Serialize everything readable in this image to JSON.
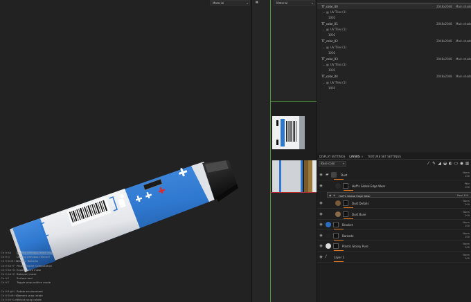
{
  "viewport3d": {
    "material_dropdown": "Material",
    "shortcuts": [
      {
        "key": "Ctrl+Alt",
        "action": "Display previous mesh map",
        "highlight": true
      },
      {
        "key": "Ctrl+Q",
        "action": "Display previous channel",
        "highlight": false
      },
      {
        "key": "Ctrl+Shift+Q",
        "action": "Display Textures",
        "highlight": false
      },
      {
        "key": "Ctrl+Alt+F",
        "action": "Pause Engine Computation",
        "highlight": false
      },
      {
        "key": "Ctrl+Alt+D",
        "action": "Export quick mask",
        "highlight": false
      },
      {
        "key": "Ctrl+Alt+E",
        "action": "Bakeport mask",
        "highlight": false
      },
      {
        "key": "Ctrl+E",
        "action": "Surface tool",
        "highlight": false
      },
      {
        "key": "Ctrl+T",
        "action": "Toggle wrap edition mode",
        "highlight": false
      },
      {
        "key": "",
        "action": "",
        "highlight": false
      },
      {
        "key": "Ctrl+Right",
        "action": "Rotate environment",
        "highlight": false
      },
      {
        "key": "Ctrl+Shift+Alt",
        "action": "Camera snap rotate",
        "highlight": false
      },
      {
        "key": "Ctrl+Alt+Left",
        "action": "Unlock snap rotate",
        "highlight": false
      }
    ]
  },
  "viewport2d": {
    "material_dropdown": "Material"
  },
  "texture_sets": [
    {
      "name": "TT_color_00",
      "resolution": "2048x2048",
      "shader": "Main shader",
      "uv_tiles_label": "UV Tiles (1)",
      "tile": "1001",
      "selected": true
    },
    {
      "name": "TT_color_01",
      "resolution": "2048x2048",
      "shader": "Main shader",
      "uv_tiles_label": "UV Tiles (1)",
      "tile": "1001",
      "selected": false
    },
    {
      "name": "TT_color_02",
      "resolution": "2048x2048",
      "shader": "Main shader",
      "uv_tiles_label": "UV Tiles (1)",
      "tile": "1001",
      "selected": false
    },
    {
      "name": "TT_color_03",
      "resolution": "2048x2048",
      "shader": "Main shader",
      "uv_tiles_label": "UV Tiles (1)",
      "tile": "1001",
      "selected": false
    },
    {
      "name": "TT_color_04",
      "resolution": "2048x2048",
      "shader": "Main shader",
      "uv_tiles_label": "UV Tiles (1)",
      "tile": "1001",
      "selected": false
    }
  ],
  "tabs": [
    {
      "label": "DISPLAY SETTINGS",
      "active": false,
      "closable": false
    },
    {
      "label": "LAYERS",
      "active": true,
      "closable": true
    },
    {
      "label": "TEXTURE SET SETTINGS",
      "active": false,
      "closable": false
    }
  ],
  "layer_toolbar": {
    "blend_mode": "Base color",
    "tools": [
      "brush-icon",
      "pen-icon",
      "fill-icon",
      "bucket-icon",
      "palette-icon",
      "folder-icon",
      "mask-icon",
      "trash-icon"
    ]
  },
  "layers": [
    {
      "name": "Dust",
      "blend": "Norm",
      "opacity": "100",
      "thumb": "#444444",
      "type": "folder"
    },
    {
      "name": "Huff's Global Edge Wear",
      "blend": "Pthr",
      "opacity": "100",
      "thumb": "#2a2a2a",
      "type": "fill"
    },
    {
      "name": "Huff's Global Edge Wear",
      "blend": "Repl",
      "opacity": "100",
      "thumb": "#1f1f1f",
      "type": "effect"
    },
    {
      "name": "Dust Details",
      "blend": "Norm",
      "opacity": "100",
      "thumb": "#7a5a3a",
      "type": "fill"
    },
    {
      "name": "Dust Base",
      "blend": "Norm",
      "opacity": "100",
      "thumb": "#8a6a4a",
      "type": "fill"
    },
    {
      "name": "Bracket",
      "blend": "Norm",
      "opacity": "100",
      "thumb": "#2a6fc2",
      "type": "fill"
    },
    {
      "name": "Barcode",
      "blend": "Norm",
      "opacity": "100",
      "thumb": "#222222",
      "type": "fill"
    },
    {
      "name": "Plastic Glossy Pure",
      "blend": "Norm",
      "opacity": "100",
      "thumb": "#dcdcdc",
      "type": "fill"
    },
    {
      "name": "Layer 1",
      "blend": "Norm",
      "opacity": "100",
      "thumb": "#333333",
      "type": "paint"
    }
  ],
  "colors": {
    "accent": "#e07a25",
    "object_blue": "#2f78cf",
    "object_white": "#eef0f2"
  }
}
